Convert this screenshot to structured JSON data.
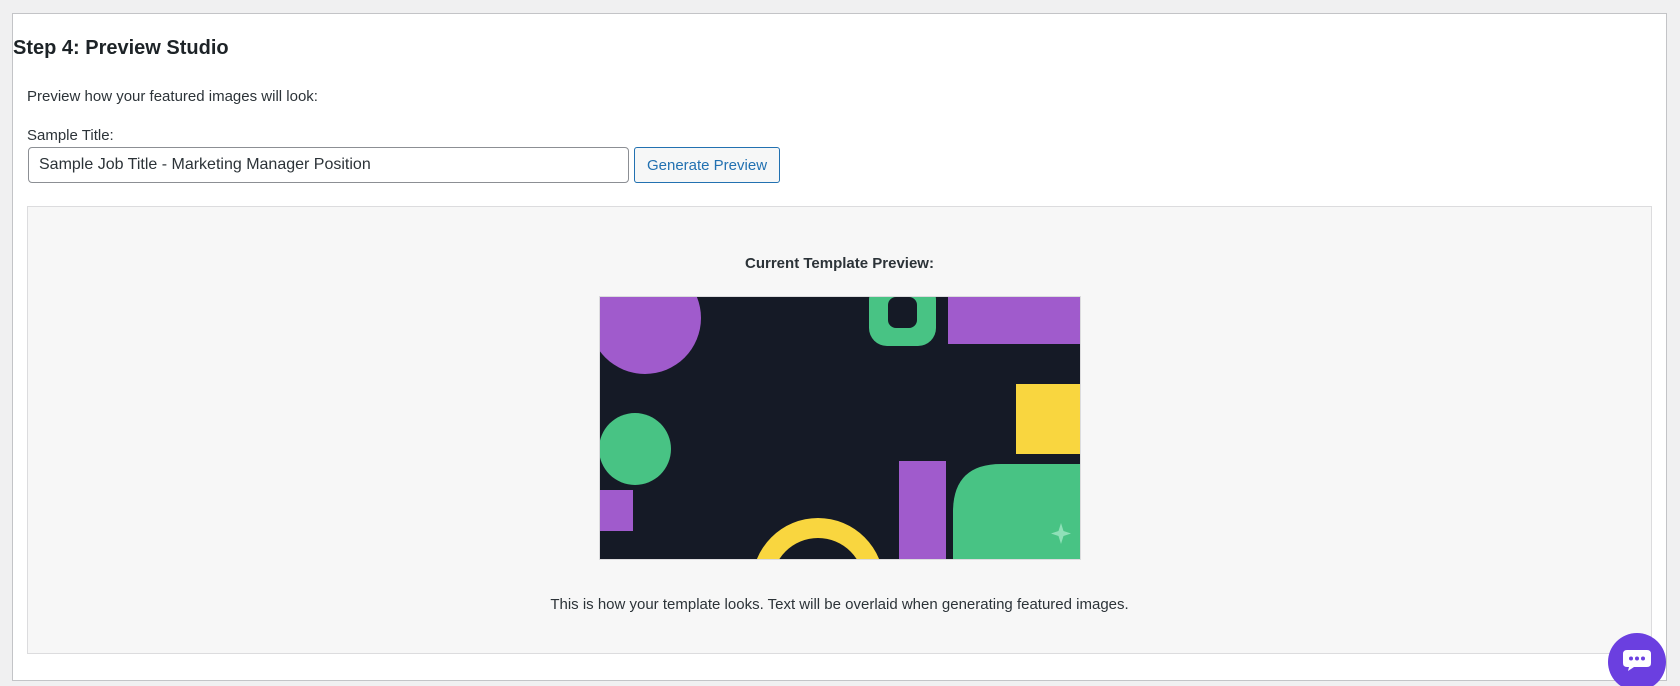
{
  "step": {
    "title": "Step 4: Preview Studio",
    "intro": "Preview how your featured images will look:"
  },
  "form": {
    "label": "Sample Title:",
    "value": "Sample Job Title - Marketing Manager Position",
    "button_label": "Generate Preview"
  },
  "preview": {
    "heading": "Current Template Preview:",
    "note": "This is how your template looks. Text will be overlaid when generating featured images.",
    "colors": {
      "background": "#151a26",
      "purple": "#a05bcc",
      "green": "#48c384",
      "yellow": "#f9d63f"
    }
  },
  "chat": {
    "icon": "chat-bubble-icon",
    "color": "#6b3fe0"
  },
  "colors": {
    "accent": "#2271b1"
  }
}
